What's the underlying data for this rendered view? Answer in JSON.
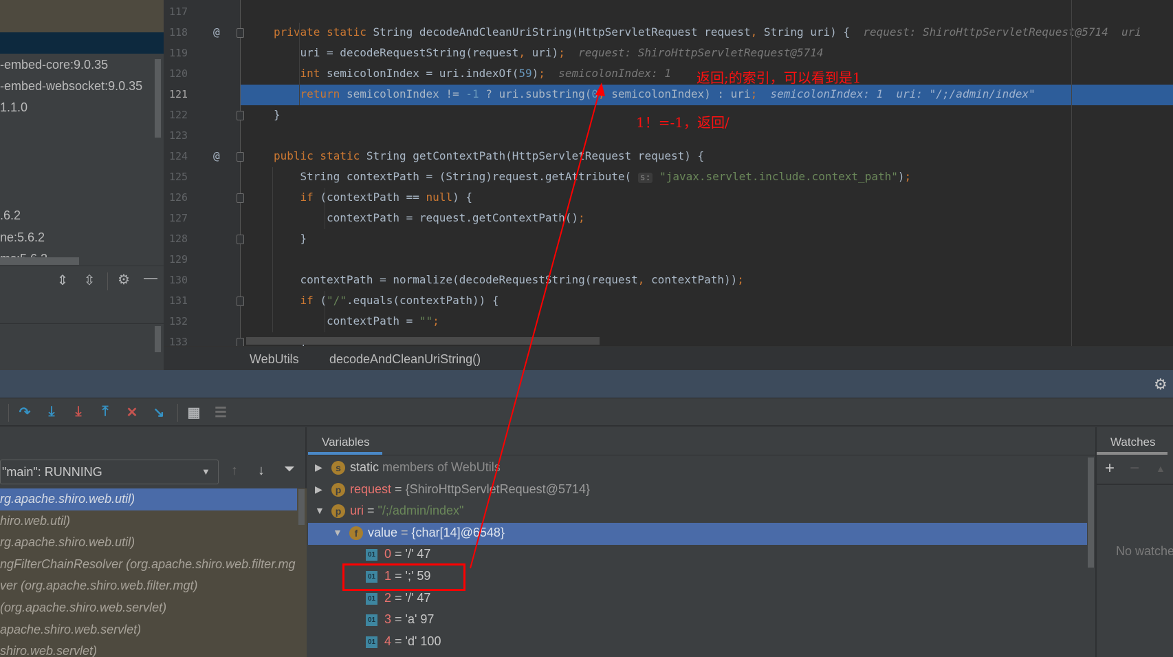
{
  "project_panel": {
    "items": [
      "-embed-core:9.0.35",
      "-embed-websocket:9.0.35",
      "1.1.0",
      ".6.2",
      "ne:5.6.2",
      "ms:5.6.2"
    ],
    "toolbar_icons": [
      "expand-all-icon",
      "collapse-all-icon",
      "gear-icon",
      "minimize-icon"
    ]
  },
  "editor": {
    "lines": [
      {
        "n": "117",
        "at": false,
        "fold": false,
        "indent": 0,
        "tokens": []
      },
      {
        "n": "118",
        "at": true,
        "fold": true,
        "indent": 0,
        "tokens": [
          [
            "kw",
            "private static "
          ],
          [
            "",
            "String decodeAndCleanUriString(HttpServletRequest request"
          ],
          [
            "p",
            ", "
          ],
          [
            "",
            "String uri) {  "
          ],
          [
            "hint",
            "request: ShiroHttpServletRequest@5714  uri"
          ]
        ]
      },
      {
        "n": "119",
        "at": false,
        "fold": false,
        "indent": 1,
        "tokens": [
          [
            "",
            "uri = decodeRequestString(request"
          ],
          [
            "p",
            ", "
          ],
          [
            "",
            "uri)"
          ],
          [
            "p",
            ";"
          ],
          [
            "hint",
            "  request: ShiroHttpServletRequest@5714"
          ]
        ]
      },
      {
        "n": "120",
        "at": false,
        "fold": false,
        "indent": 1,
        "tokens": [
          [
            "kw",
            "int "
          ],
          [
            "",
            "semicolonIndex = uri.indexOf("
          ],
          [
            "num",
            "59"
          ],
          [
            "",
            ")"
          ],
          [
            "p",
            ";"
          ],
          [
            "hint",
            "  semicolonIndex: 1"
          ]
        ]
      },
      {
        "n": "121",
        "at": false,
        "fold": false,
        "indent": 1,
        "current": true,
        "tokens": [
          [
            "kw",
            "return "
          ],
          [
            "",
            "semicolonIndex != "
          ],
          [
            "num",
            "-1"
          ],
          [
            "",
            " ? uri.substring("
          ],
          [
            "num",
            "0"
          ],
          [
            "p",
            ", "
          ],
          [
            "",
            "semicolonIndex) : uri"
          ],
          [
            "p",
            ";"
          ],
          [
            "hint",
            "  semicolonIndex: 1  uri: \"/;/admin/index\""
          ]
        ]
      },
      {
        "n": "122",
        "at": false,
        "fold": true,
        "indent": 0,
        "tokens": [
          [
            "",
            "}"
          ]
        ]
      },
      {
        "n": "123",
        "at": false,
        "fold": false,
        "indent": 0,
        "tokens": []
      },
      {
        "n": "124",
        "at": true,
        "fold": true,
        "indent": 0,
        "tokens": [
          [
            "kw",
            "public static "
          ],
          [
            "",
            "String getContextPath(HttpServletRequest request) {"
          ]
        ]
      },
      {
        "n": "125",
        "at": false,
        "fold": false,
        "indent": 1,
        "tokens": [
          [
            "",
            "String contextPath = (String)request.getAttribute( "
          ],
          [
            "param",
            "s:"
          ],
          [
            "str",
            " \"javax.servlet.include.context_path\""
          ],
          [
            "",
            ")"
          ],
          [
            "p",
            ";"
          ]
        ]
      },
      {
        "n": "126",
        "at": false,
        "fold": true,
        "indent": 1,
        "tokens": [
          [
            "kw",
            "if "
          ],
          [
            "",
            "(contextPath == "
          ],
          [
            "kw",
            "null"
          ],
          [
            "",
            ") {"
          ]
        ]
      },
      {
        "n": "127",
        "at": false,
        "fold": false,
        "indent": 2,
        "tokens": [
          [
            "",
            "contextPath = request.getContextPath()"
          ],
          [
            "p",
            ";"
          ]
        ]
      },
      {
        "n": "128",
        "at": false,
        "fold": true,
        "indent": 1,
        "tokens": [
          [
            "",
            "}"
          ]
        ]
      },
      {
        "n": "129",
        "at": false,
        "fold": false,
        "indent": 0,
        "tokens": []
      },
      {
        "n": "130",
        "at": false,
        "fold": false,
        "indent": 1,
        "tokens": [
          [
            "",
            "contextPath = normalize(decodeRequestString(request"
          ],
          [
            "p",
            ", "
          ],
          [
            "",
            "contextPath))"
          ],
          [
            "p",
            ";"
          ]
        ]
      },
      {
        "n": "131",
        "at": false,
        "fold": true,
        "indent": 1,
        "tokens": [
          [
            "kw",
            "if "
          ],
          [
            "",
            "("
          ],
          [
            "str",
            "\"/\""
          ],
          [
            "",
            ".equals(contextPath)) {"
          ]
        ]
      },
      {
        "n": "132",
        "at": false,
        "fold": false,
        "indent": 2,
        "tokens": [
          [
            "",
            "contextPath = "
          ],
          [
            "str",
            "\"\""
          ],
          [
            "p",
            ";"
          ]
        ]
      },
      {
        "n": "133",
        "at": false,
        "fold": true,
        "indent": 1,
        "tokens": [
          [
            "",
            "}"
          ]
        ]
      }
    ]
  },
  "breadcrumb": {
    "class": "WebUtils",
    "method": "decodeAndCleanUriString()"
  },
  "annotations": {
    "note1": "返回;的索引，可以看到是1",
    "note2": "1！=-1，返回/",
    "color": "#ff0000"
  },
  "debug": {
    "toolbar": [
      {
        "icon": "step-over-icon",
        "color": "#3592c4",
        "glyph": "↷"
      },
      {
        "icon": "step-into-icon",
        "color": "#3592c4",
        "glyph": "⤓"
      },
      {
        "icon": "force-step-into-icon",
        "color": "#c75450",
        "glyph": "⤓"
      },
      {
        "icon": "step-out-icon",
        "color": "#3592c4",
        "glyph": "⤒"
      },
      {
        "icon": "drop-frame-icon",
        "color": "#c75450",
        "glyph": "✕"
      },
      {
        "icon": "run-to-cursor-icon",
        "color": "#3592c4",
        "glyph": "↘"
      },
      {
        "icon": "evaluate-expression-icon",
        "color": "#afb1b3",
        "glyph": "▦"
      },
      {
        "icon": "trace-icon",
        "color": "#6e6e6e",
        "glyph": "☰"
      }
    ],
    "thread": "\"main\": RUNNING",
    "frames": [
      "rg.apache.shiro.web.util)",
      "hiro.web.util)",
      "rg.apache.shiro.web.util)",
      "ngFilterChainResolver (org.apache.shiro.web.filter.mg",
      "ver (org.apache.shiro.web.filter.mgt)",
      "(org.apache.shiro.web.servlet)",
      "apache.shiro.web.servlet)",
      "shiro.web.servlet)"
    ],
    "variables_tab": "Variables",
    "variables": [
      {
        "level": 0,
        "expand": "collapsed",
        "badge": "s",
        "name": "static",
        "rest": " members of WebUtils",
        "static": true
      },
      {
        "level": 0,
        "expand": "collapsed",
        "badge": "p",
        "name": "request",
        "eq": " = ",
        "value": "{ShiroHttpServletRequest@5714}"
      },
      {
        "level": 0,
        "expand": "expanded",
        "badge": "p",
        "name": "uri",
        "eq": " = ",
        "value": "\"/;/admin/index\"",
        "string": true
      },
      {
        "level": 1,
        "expand": "expanded",
        "badge": "f",
        "name": "value",
        "eq": " = ",
        "value": "{char[14]@6548}",
        "selected": true
      },
      {
        "level": 2,
        "badge": "01",
        "name": "0",
        "eq": " = ",
        "value": "'/' 47"
      },
      {
        "level": 2,
        "badge": "01",
        "name": "1",
        "eq": " = ",
        "value": "';' 59",
        "boxed": true
      },
      {
        "level": 2,
        "badge": "01",
        "name": "2",
        "eq": " = ",
        "value": "'/' 47"
      },
      {
        "level": 2,
        "badge": "01",
        "name": "3",
        "eq": " = ",
        "value": "'a' 97"
      },
      {
        "level": 2,
        "badge": "01",
        "name": "4",
        "eq": " = ",
        "value": "'d' 100"
      }
    ],
    "watches_tab": "Watches",
    "watches_empty": "No watche"
  }
}
